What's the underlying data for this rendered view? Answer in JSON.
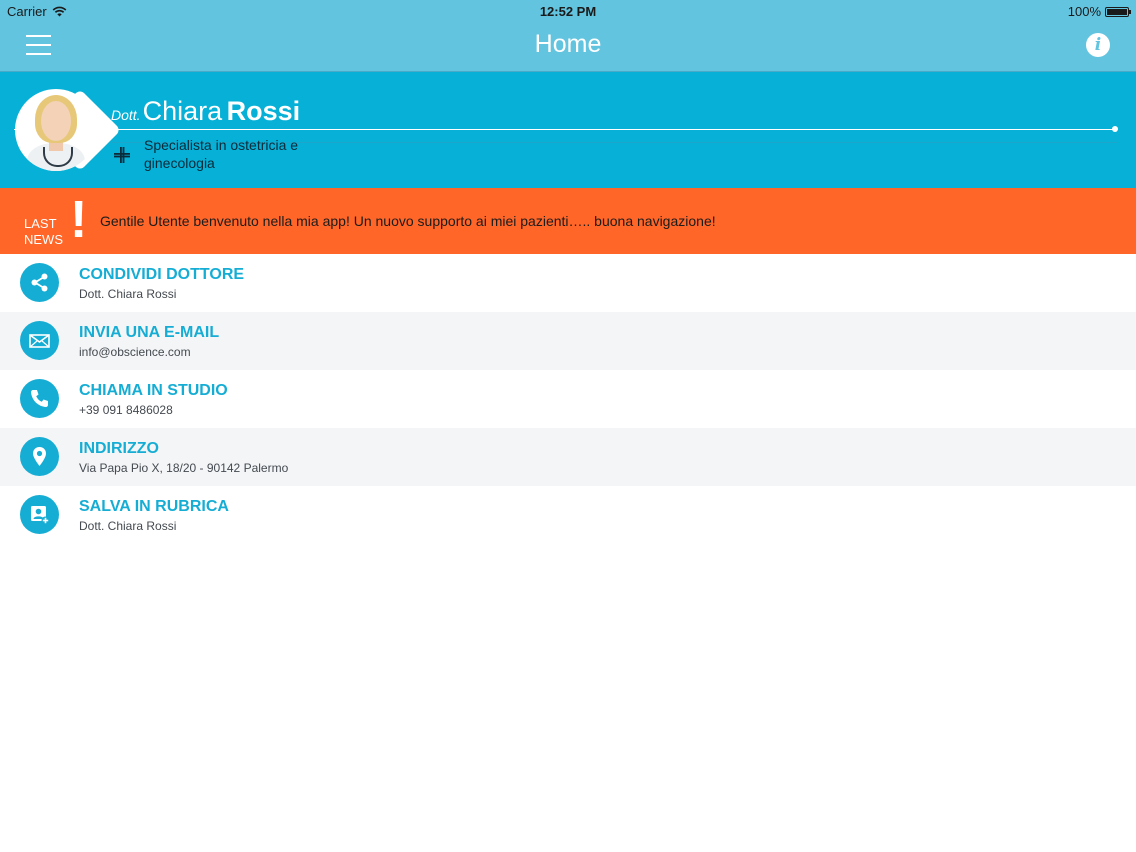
{
  "status_bar": {
    "carrier": "Carrier",
    "time": "12:52 PM",
    "battery": "100%"
  },
  "nav": {
    "title": "Home"
  },
  "profile": {
    "prefix": "Dott.",
    "first_name": "Chiara",
    "last_name": "Rossi",
    "specialty": "Specialista in ostetricia e ginecologia"
  },
  "news": {
    "label_line1": "LAST",
    "label_line2": "NEWS",
    "mark": "!",
    "text": "Gentile Utente benvenuto nella mia app! Un nuovo supporto ai miei pazienti….. buona navigazione!"
  },
  "menu": [
    {
      "title": "CONDIVIDI DOTTORE",
      "subtitle": "Dott. Chiara Rossi",
      "icon": "share-icon"
    },
    {
      "title": "INVIA UNA E-MAIL",
      "subtitle": "info@obscience.com",
      "icon": "mail-icon"
    },
    {
      "title": "CHIAMA IN STUDIO",
      "subtitle": "+39 091 8486028",
      "icon": "phone-icon"
    },
    {
      "title": "INDIRIZZO",
      "subtitle": "Via Papa Pio X, 18/20 - 90142 Palermo",
      "icon": "location-pin-icon"
    },
    {
      "title": "SALVA IN RUBRICA",
      "subtitle": "Dott. Chiara Rossi",
      "icon": "add-contact-icon"
    }
  ],
  "colors": {
    "nav": "#62c4df",
    "profile": "#06b0d6",
    "news": "#ff6628",
    "accent": "#16add4"
  }
}
